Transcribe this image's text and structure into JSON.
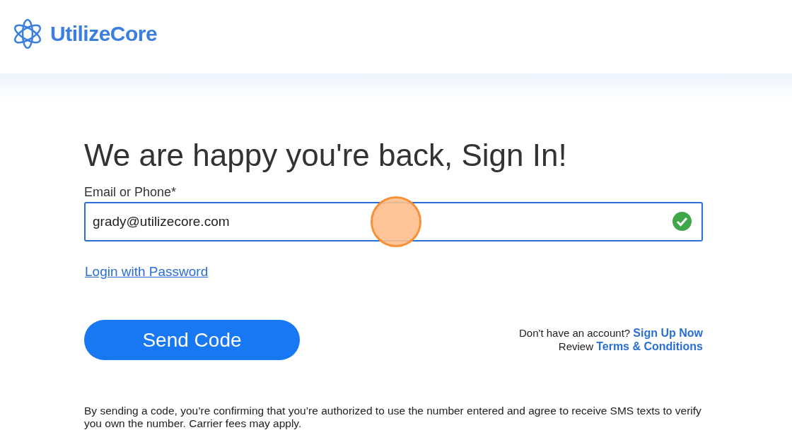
{
  "header": {
    "logo_text": "UtilizeCore"
  },
  "heading": "We are happy you're back, Sign In!",
  "field": {
    "label": "Email or Phone*",
    "value": "grady@utilizecore.com",
    "focused": true,
    "valid": true
  },
  "password_link": "Login with Password",
  "send_button": "Send Code",
  "signup": {
    "text": "Don't have an account?",
    "link": "Sign Up Now"
  },
  "terms": {
    "text": "Review",
    "link": "Terms & Conditions"
  },
  "disclaimer": "By sending a code, you’re confirming that you’re authorized to use the number entered and agree to receive SMS texts to verify you own the number. Carrier fees may apply."
}
